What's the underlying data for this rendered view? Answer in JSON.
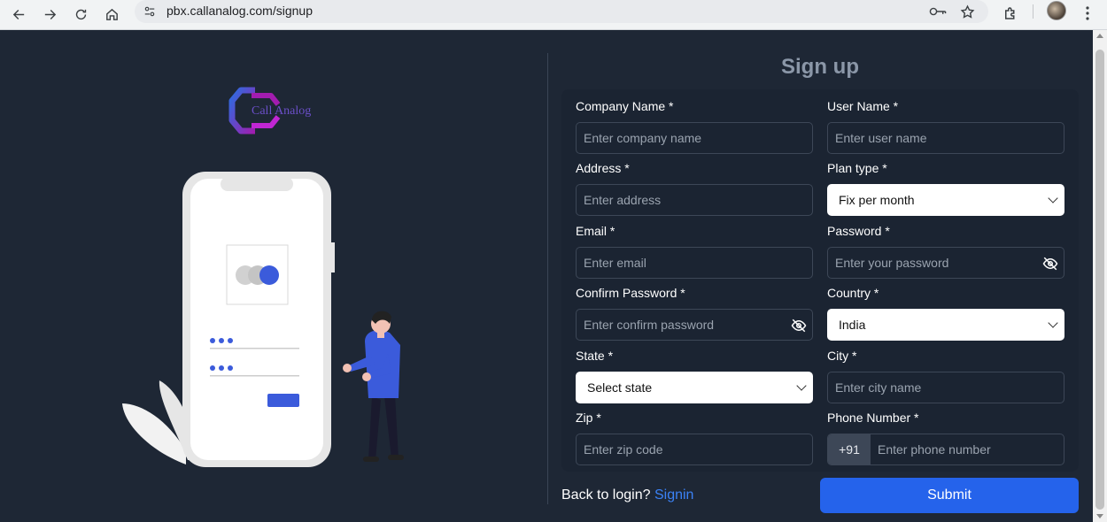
{
  "browser": {
    "url": "pbx.callanalog.com/signup"
  },
  "logo": {
    "text": "Call Analog"
  },
  "form": {
    "title": "Sign up",
    "fields": {
      "company_name": {
        "label": "Company Name *",
        "placeholder": "Enter company name"
      },
      "user_name": {
        "label": "User Name *",
        "placeholder": "Enter user name"
      },
      "address": {
        "label": "Address *",
        "placeholder": "Enter address"
      },
      "plan_type": {
        "label": "Plan type *",
        "value": "Fix per month"
      },
      "email": {
        "label": "Email *",
        "placeholder": "Enter email"
      },
      "password": {
        "label": "Password *",
        "placeholder": "Enter your password"
      },
      "confirm_password": {
        "label": "Confirm Password *",
        "placeholder": "Enter confirm password"
      },
      "country": {
        "label": "Country *",
        "value": "India"
      },
      "state": {
        "label": "State *",
        "value": "Select state"
      },
      "city": {
        "label": "City *",
        "placeholder": "Enter city name"
      },
      "zip": {
        "label": "Zip *",
        "placeholder": "Enter zip code"
      },
      "phone": {
        "label": "Phone Number *",
        "prefix": "+91",
        "placeholder": "Enter phone number"
      }
    },
    "back_text": "Back to login?",
    "signin_link": "Signin",
    "submit_label": "Submit"
  },
  "colors": {
    "background": "#1e2735",
    "card": "#1b2432",
    "accent": "#2563eb",
    "link": "#3b82f6",
    "illustration_accent": "#3b5bdb"
  }
}
